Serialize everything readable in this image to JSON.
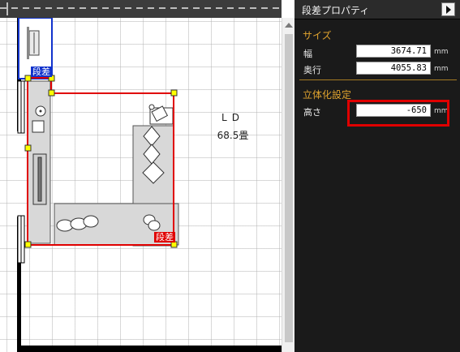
{
  "canvas": {
    "room": {
      "name": "LD",
      "area": "68.5畳"
    },
    "badges": {
      "top": "段差",
      "bottom": "段差"
    }
  },
  "panel": {
    "title": "段差プロパティ",
    "size_section": {
      "title": "サイズ",
      "width_label": "幅",
      "width_value": "3674.71",
      "depth_label": "奥行",
      "depth_value": "4055.83",
      "unit": "mm"
    },
    "solid_section": {
      "title": "立体化設定",
      "height_label": "高さ",
      "height_value": "-650",
      "unit": "mm"
    }
  },
  "colors": {
    "selection_red": "#e00000",
    "handle_yellow": "#ffff00",
    "wall_black": "#000000",
    "badge_blue": "#1133cc",
    "panel_bg": "#1a1a1a",
    "section_orange": "#e0a32e"
  },
  "icons": [
    "panel-toggle-arrow-icon",
    "scroll-up-arrow-icon"
  ]
}
